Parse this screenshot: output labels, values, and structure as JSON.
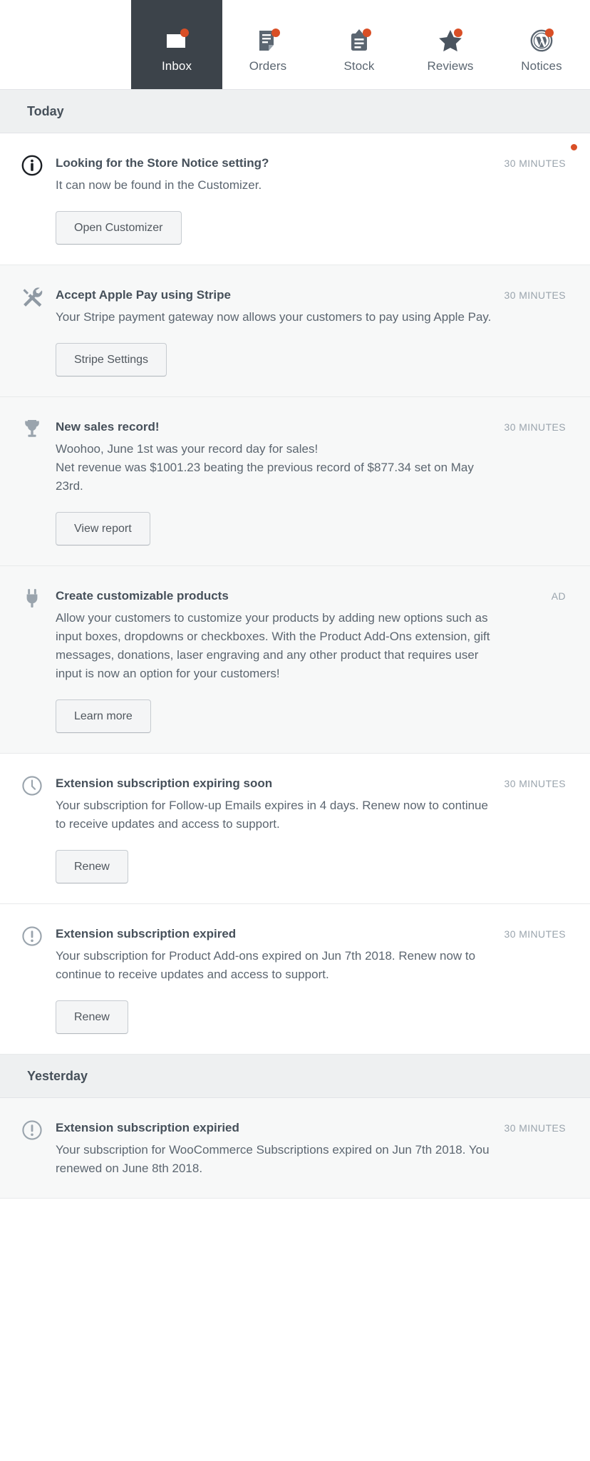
{
  "tabs": [
    {
      "label": "Inbox",
      "icon": "inbox-icon",
      "active": true,
      "badge": true
    },
    {
      "label": "Orders",
      "icon": "orders-icon",
      "active": false,
      "badge": true
    },
    {
      "label": "Stock",
      "icon": "stock-icon",
      "active": false,
      "badge": true
    },
    {
      "label": "Reviews",
      "icon": "reviews-star-icon",
      "active": false,
      "badge": true
    },
    {
      "label": "Notices",
      "icon": "wordpress-icon",
      "active": false,
      "badge": true
    }
  ],
  "colors": {
    "accent_dot": "#d94f26",
    "active_tab_bg": "#3c434a",
    "section_header_bg": "#eef0f1",
    "shaded_row_bg": "#f7f8f8",
    "title_text": "#46505a",
    "body_text": "#5c6670",
    "time_text": "#9aa4ad"
  },
  "sections": [
    {
      "title": "Today",
      "notes": [
        {
          "icon": "info-circle-icon",
          "title": "Looking for the Store Notice setting?",
          "time": "30 MINUTES",
          "text": "It can now be found in the Customizer.",
          "action": "Open Customizer",
          "shaded": false,
          "unread": true
        },
        {
          "icon": "tools-icon",
          "title": "Accept Apple Pay using Stripe",
          "time": "30 MINUTES",
          "text": "Your Stripe payment gateway now allows your customers to pay using Apple Pay.",
          "action": "Stripe Settings",
          "shaded": true,
          "unread": false
        },
        {
          "icon": "trophy-icon",
          "title": "New sales record!",
          "time": "30 MINUTES",
          "text": "Woohoo, June 1st was your record day for sales!\nNet revenue was $1001.23 beating the previous record of $877.34 set on May 23rd.",
          "action": "View report",
          "shaded": true,
          "unread": false
        },
        {
          "icon": "plug-icon",
          "title": "Create customizable products",
          "time": "AD",
          "text": "Allow your customers to customize your products by adding new options such as input boxes, dropdowns or checkboxes. With the Product Add-Ons extension, gift messages, donations, laser engraving and any other product that requires user input is now an option for your customers!",
          "action": "Learn more",
          "shaded": true,
          "unread": false
        },
        {
          "icon": "clock-icon",
          "title": "Extension subscription expiring soon",
          "time": "30 MINUTES",
          "text": "Your subscription for Follow-up Emails expires in 4 days. Renew now to continue to receive updates and access to support.",
          "action": "Renew",
          "shaded": false,
          "unread": false
        },
        {
          "icon": "alert-circle-icon",
          "title": "Extension subscription expired",
          "time": "30 MINUTES",
          "text": "Your subscription for Product Add-ons expired on Jun 7th 2018. Renew now to continue to receive updates and access to support.",
          "action": "Renew",
          "shaded": false,
          "unread": false
        }
      ]
    },
    {
      "title": "Yesterday",
      "notes": [
        {
          "icon": "alert-circle-icon",
          "title": "Extension subscription expiried",
          "time": "30 MINUTES",
          "text": "Your subscription for WooCommerce Subscriptions expired on Jun 7th 2018. You renewed on June 8th 2018.",
          "action": null,
          "shaded": true,
          "unread": false
        }
      ]
    }
  ]
}
